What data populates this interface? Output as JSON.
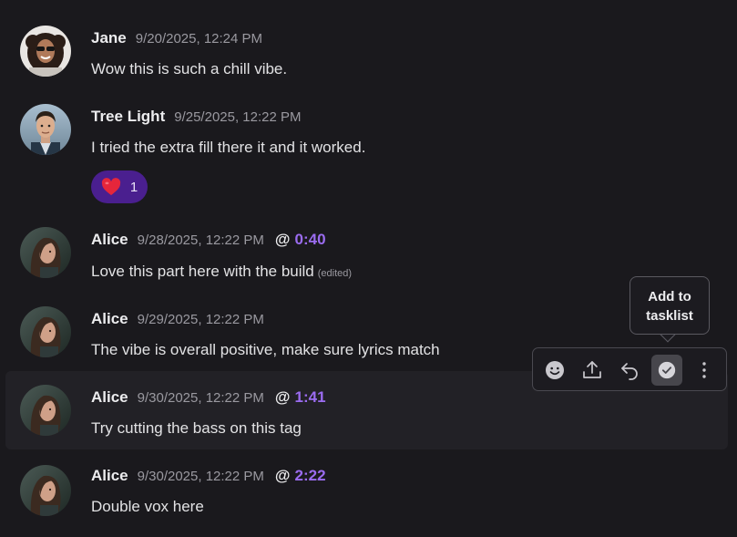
{
  "messages": [
    {
      "author": "Jane",
      "time": "9/20/2025, 12:24 PM",
      "text": "Wow this is such a chill vibe."
    },
    {
      "author": "Tree Light",
      "time": "9/25/2025, 12:22 PM",
      "text": "I tried the extra fill there it and it worked.",
      "reaction": {
        "emoji": "heart",
        "count": "1"
      }
    },
    {
      "author": "Alice",
      "time": "9/28/2025, 12:22 PM",
      "at": "@",
      "timestamp": "0:40",
      "text": "Love this part here with the build",
      "edited": "(edited)"
    },
    {
      "author": "Alice",
      "time": "9/29/2025, 12:22 PM",
      "text": "The vibe is overall positive, make sure lyrics match"
    },
    {
      "author": "Alice",
      "time": "9/30/2025, 12:22 PM",
      "at": "@",
      "timestamp": "1:41",
      "text": "Try cutting the bass on this tag"
    },
    {
      "author": "Alice",
      "time": "9/30/2025, 12:22 PM",
      "at": "@",
      "timestamp": "2:22",
      "text": "Double vox here"
    }
  ],
  "toolbar": {
    "actions": [
      "emoji-icon",
      "upload-icon",
      "reply-icon",
      "check-circle-icon",
      "more-vertical-icon"
    ],
    "active": "check-circle-icon",
    "tooltip_line1": "Add to",
    "tooltip_line2": "tasklist"
  },
  "colors": {
    "background": "#1a191d",
    "hover_row": "#222126",
    "accent_timestamp": "#9b6cf0",
    "reaction_bg": "#4a1f8f"
  }
}
